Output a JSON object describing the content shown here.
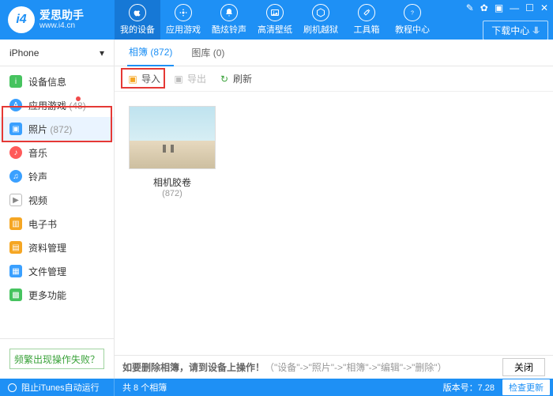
{
  "brand": {
    "name": "爱思助手",
    "url": "www.i4.cn",
    "badge": "i4"
  },
  "topnav": [
    {
      "label": "我的设备",
      "icon": "apple"
    },
    {
      "label": "应用游戏",
      "icon": "apps"
    },
    {
      "label": "酷炫铃声",
      "icon": "bell"
    },
    {
      "label": "高清壁纸",
      "icon": "image"
    },
    {
      "label": "刷机越狱",
      "icon": "box"
    },
    {
      "label": "工具箱",
      "icon": "tools"
    },
    {
      "label": "教程中心",
      "icon": "help"
    }
  ],
  "download_btn": "下载中心",
  "device": {
    "name": "iPhone"
  },
  "sidebar": [
    {
      "label": "设备信息",
      "color": "#46c35f"
    },
    {
      "label": "应用游戏",
      "count": "(48)",
      "color": "#3aa0ff",
      "dot": true
    },
    {
      "label": "照片",
      "count": "(872)",
      "color": "#3aa0ff",
      "active": true
    },
    {
      "label": "音乐",
      "color": "#ff5a5a"
    },
    {
      "label": "铃声",
      "color": "#3aa0ff"
    },
    {
      "label": "视频",
      "color": "#8e8e8e"
    },
    {
      "label": "电子书",
      "color": "#f5a623"
    },
    {
      "label": "资料管理",
      "color": "#f5a623"
    },
    {
      "label": "文件管理",
      "color": "#3aa0ff"
    },
    {
      "label": "更多功能",
      "color": "#46c35f"
    }
  ],
  "help_link": "频繁出现操作失败？",
  "tabs": [
    {
      "label": "相簿",
      "count": "(872)",
      "active": true
    },
    {
      "label": "图库",
      "count": "(0)"
    }
  ],
  "tools": {
    "import": "导入",
    "export": "导出",
    "refresh": "刷新"
  },
  "album": {
    "name": "相机胶卷",
    "count": "(872)"
  },
  "hint": {
    "bold": "如要删除相簿，请到设备上操作！",
    "gray": "（\"设备\"->\"照片\"->\"相簿\"->\"编辑\"->\"删除\"）",
    "close": "关闭"
  },
  "status": {
    "itunes": "阻止iTunes自动运行",
    "summary": "共 8 个相簿",
    "version_label": "版本号：",
    "version": "7.28",
    "update": "检查更新"
  }
}
